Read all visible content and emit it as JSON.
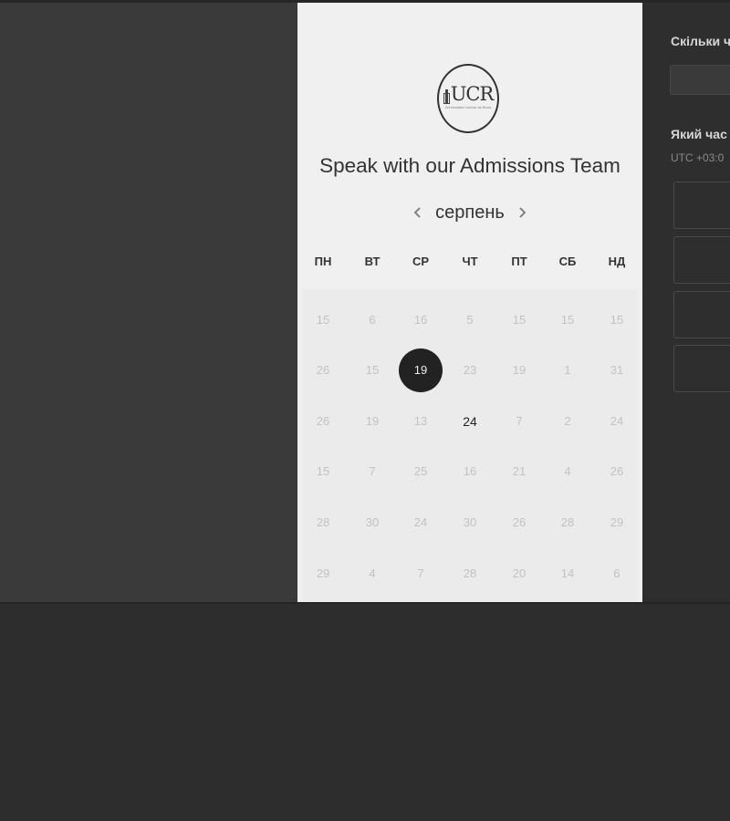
{
  "calendar": {
    "logo_text": "UCR",
    "logo_tagline": "Universidad Central de Rivas",
    "title": "Speak with our Admissions Team",
    "month": "серпень",
    "prev_icon": "chevron-left-icon",
    "next_icon": "chevron-right-icon",
    "weekdays": [
      "ПН",
      "ВТ",
      "СР",
      "ЧТ",
      "ПТ",
      "СБ",
      "НД"
    ],
    "weeks": [
      [
        "15",
        "6",
        "16",
        "5",
        "15",
        "15",
        "15"
      ],
      [
        "26",
        "15",
        "19",
        "23",
        "19",
        "1",
        "31"
      ],
      [
        "26",
        "19",
        "13",
        "24",
        "7",
        "2",
        "24"
      ],
      [
        "15",
        "7",
        "25",
        "16",
        "21",
        "4",
        "26"
      ],
      [
        "28",
        "30",
        "24",
        "30",
        "26",
        "28",
        "29"
      ],
      [
        "29",
        "4",
        "7",
        "28",
        "20",
        "14",
        "6"
      ]
    ],
    "selected_day": "19",
    "available_day": "24"
  },
  "booking": {
    "duration_label": "Скільки ч",
    "time_label": "Який час",
    "timezone": "UTC +03:0"
  },
  "colors": {
    "overlay": "#3a3a3a",
    "panel": "#f0f0f0",
    "selected": "#222222",
    "muted_day": "#c2c2c2"
  }
}
